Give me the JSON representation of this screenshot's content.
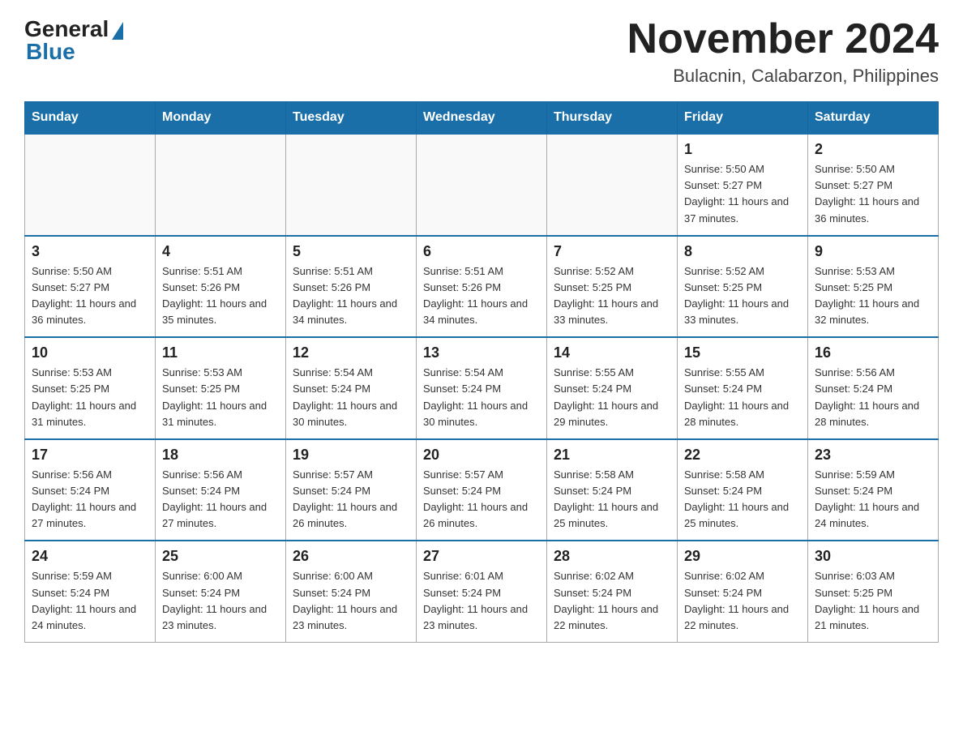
{
  "header": {
    "logo_general": "General",
    "logo_blue": "Blue",
    "main_title": "November 2024",
    "subtitle": "Bulacnin, Calabarzon, Philippines"
  },
  "calendar": {
    "days_of_week": [
      "Sunday",
      "Monday",
      "Tuesday",
      "Wednesday",
      "Thursday",
      "Friday",
      "Saturday"
    ],
    "weeks": [
      [
        {
          "day": "",
          "info": ""
        },
        {
          "day": "",
          "info": ""
        },
        {
          "day": "",
          "info": ""
        },
        {
          "day": "",
          "info": ""
        },
        {
          "day": "",
          "info": ""
        },
        {
          "day": "1",
          "info": "Sunrise: 5:50 AM\nSunset: 5:27 PM\nDaylight: 11 hours and 37 minutes."
        },
        {
          "day": "2",
          "info": "Sunrise: 5:50 AM\nSunset: 5:27 PM\nDaylight: 11 hours and 36 minutes."
        }
      ],
      [
        {
          "day": "3",
          "info": "Sunrise: 5:50 AM\nSunset: 5:27 PM\nDaylight: 11 hours and 36 minutes."
        },
        {
          "day": "4",
          "info": "Sunrise: 5:51 AM\nSunset: 5:26 PM\nDaylight: 11 hours and 35 minutes."
        },
        {
          "day": "5",
          "info": "Sunrise: 5:51 AM\nSunset: 5:26 PM\nDaylight: 11 hours and 34 minutes."
        },
        {
          "day": "6",
          "info": "Sunrise: 5:51 AM\nSunset: 5:26 PM\nDaylight: 11 hours and 34 minutes."
        },
        {
          "day": "7",
          "info": "Sunrise: 5:52 AM\nSunset: 5:25 PM\nDaylight: 11 hours and 33 minutes."
        },
        {
          "day": "8",
          "info": "Sunrise: 5:52 AM\nSunset: 5:25 PM\nDaylight: 11 hours and 33 minutes."
        },
        {
          "day": "9",
          "info": "Sunrise: 5:53 AM\nSunset: 5:25 PM\nDaylight: 11 hours and 32 minutes."
        }
      ],
      [
        {
          "day": "10",
          "info": "Sunrise: 5:53 AM\nSunset: 5:25 PM\nDaylight: 11 hours and 31 minutes."
        },
        {
          "day": "11",
          "info": "Sunrise: 5:53 AM\nSunset: 5:25 PM\nDaylight: 11 hours and 31 minutes."
        },
        {
          "day": "12",
          "info": "Sunrise: 5:54 AM\nSunset: 5:24 PM\nDaylight: 11 hours and 30 minutes."
        },
        {
          "day": "13",
          "info": "Sunrise: 5:54 AM\nSunset: 5:24 PM\nDaylight: 11 hours and 30 minutes."
        },
        {
          "day": "14",
          "info": "Sunrise: 5:55 AM\nSunset: 5:24 PM\nDaylight: 11 hours and 29 minutes."
        },
        {
          "day": "15",
          "info": "Sunrise: 5:55 AM\nSunset: 5:24 PM\nDaylight: 11 hours and 28 minutes."
        },
        {
          "day": "16",
          "info": "Sunrise: 5:56 AM\nSunset: 5:24 PM\nDaylight: 11 hours and 28 minutes."
        }
      ],
      [
        {
          "day": "17",
          "info": "Sunrise: 5:56 AM\nSunset: 5:24 PM\nDaylight: 11 hours and 27 minutes."
        },
        {
          "day": "18",
          "info": "Sunrise: 5:56 AM\nSunset: 5:24 PM\nDaylight: 11 hours and 27 minutes."
        },
        {
          "day": "19",
          "info": "Sunrise: 5:57 AM\nSunset: 5:24 PM\nDaylight: 11 hours and 26 minutes."
        },
        {
          "day": "20",
          "info": "Sunrise: 5:57 AM\nSunset: 5:24 PM\nDaylight: 11 hours and 26 minutes."
        },
        {
          "day": "21",
          "info": "Sunrise: 5:58 AM\nSunset: 5:24 PM\nDaylight: 11 hours and 25 minutes."
        },
        {
          "day": "22",
          "info": "Sunrise: 5:58 AM\nSunset: 5:24 PM\nDaylight: 11 hours and 25 minutes."
        },
        {
          "day": "23",
          "info": "Sunrise: 5:59 AM\nSunset: 5:24 PM\nDaylight: 11 hours and 24 minutes."
        }
      ],
      [
        {
          "day": "24",
          "info": "Sunrise: 5:59 AM\nSunset: 5:24 PM\nDaylight: 11 hours and 24 minutes."
        },
        {
          "day": "25",
          "info": "Sunrise: 6:00 AM\nSunset: 5:24 PM\nDaylight: 11 hours and 23 minutes."
        },
        {
          "day": "26",
          "info": "Sunrise: 6:00 AM\nSunset: 5:24 PM\nDaylight: 11 hours and 23 minutes."
        },
        {
          "day": "27",
          "info": "Sunrise: 6:01 AM\nSunset: 5:24 PM\nDaylight: 11 hours and 23 minutes."
        },
        {
          "day": "28",
          "info": "Sunrise: 6:02 AM\nSunset: 5:24 PM\nDaylight: 11 hours and 22 minutes."
        },
        {
          "day": "29",
          "info": "Sunrise: 6:02 AM\nSunset: 5:24 PM\nDaylight: 11 hours and 22 minutes."
        },
        {
          "day": "30",
          "info": "Sunrise: 6:03 AM\nSunset: 5:25 PM\nDaylight: 11 hours and 21 minutes."
        }
      ]
    ]
  }
}
